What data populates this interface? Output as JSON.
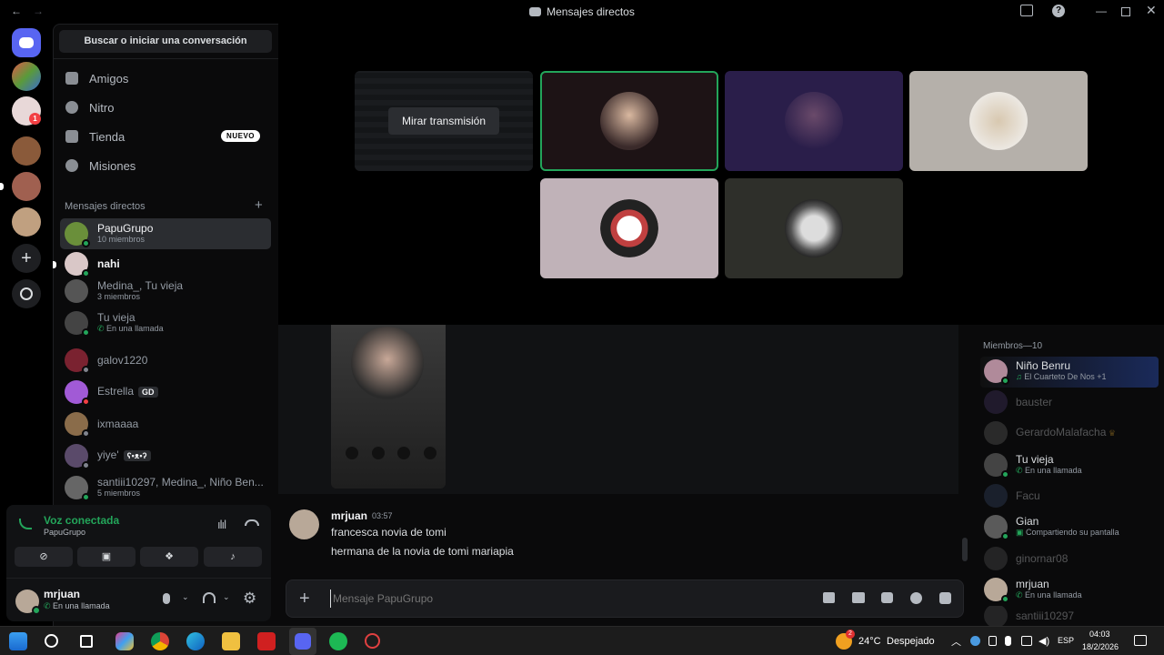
{
  "window": {
    "title": "Mensajes directos"
  },
  "sidebar": {
    "search_label": "Buscar o iniciar una conversación",
    "nav": [
      {
        "label": "Amigos"
      },
      {
        "label": "Nitro"
      },
      {
        "label": "Tienda",
        "badge": "NUEVO"
      },
      {
        "label": "Misiones"
      }
    ],
    "dm_header": "Mensajes directos",
    "dm_add": "+",
    "dms": [
      {
        "name": "PapuGrupo",
        "sub": "10 miembros",
        "color": "#6a8f3a"
      },
      {
        "name": "nahi",
        "sub": "",
        "color": "#d9c7c7"
      },
      {
        "name": "Medina_, Tu vieja",
        "sub": "3 miembros",
        "color": "#555555"
      },
      {
        "name": "Tu vieja",
        "sub": "En una llamada",
        "color": "#444444"
      },
      {
        "name": "galov1220",
        "sub": "",
        "color": "#7a2230"
      },
      {
        "name": "Estrella",
        "sub": "",
        "tag": "GD",
        "color": "#a15ad6"
      },
      {
        "name": "ixmaaaa",
        "sub": "",
        "color": "#8a6c4a"
      },
      {
        "name": "yiye'",
        "sub": "",
        "tag": "ʕ•ᴥ•ʔ",
        "color": "#5a4a6a"
      },
      {
        "name": "santiii10297, Medina_, Niño Ben...",
        "sub": "5 miembros",
        "color": "#666666"
      }
    ]
  },
  "voice": {
    "status": "Voz conectada",
    "channel": "PapuGrupo"
  },
  "user": {
    "name": "mrjuan",
    "status": "En una llamada"
  },
  "stage": {
    "watch_stream": "Mirar transmisión"
  },
  "chat": {
    "messages": [
      {
        "author": "mrjuan",
        "time": "03:57",
        "lines": [
          "francesca novia de tomi",
          "hermana de la novia de tomi mariapia"
        ]
      }
    ],
    "input_placeholder": "Mensaje PapuGrupo"
  },
  "members": {
    "header": "Miembros—10",
    "list": [
      {
        "name": "Niño Benru",
        "sub": "El Cuarteto De Nos +1",
        "color": "#b08a9a",
        "dim": false
      },
      {
        "name": "bauster",
        "sub": "",
        "color": "#4a3a6a",
        "dim": true
      },
      {
        "name": "GerardoMalafacha",
        "sub": "",
        "color": "#666666",
        "dim": true
      },
      {
        "name": "Tu vieja",
        "sub": "En una llamada",
        "color": "#444444",
        "dim": false
      },
      {
        "name": "Facu",
        "sub": "",
        "color": "#3a4a6a",
        "dim": true
      },
      {
        "name": "Gian",
        "sub": "Compartiendo su pantalla",
        "color": "#5a5a5a",
        "dim": false
      },
      {
        "name": "ginornar08",
        "sub": "",
        "color": "#555555",
        "dim": true
      },
      {
        "name": "mrjuan",
        "sub": "En una llamada",
        "color": "#b8a898",
        "dim": false
      },
      {
        "name": "santiii10297",
        "sub": "",
        "color": "#555555",
        "dim": true
      }
    ]
  },
  "taskbar": {
    "weather_temp": "24°C",
    "weather_desc": "Despejado",
    "weather_badge": "2",
    "lang": "ESP",
    "time": "04:03",
    "date": "18/2/2026"
  }
}
